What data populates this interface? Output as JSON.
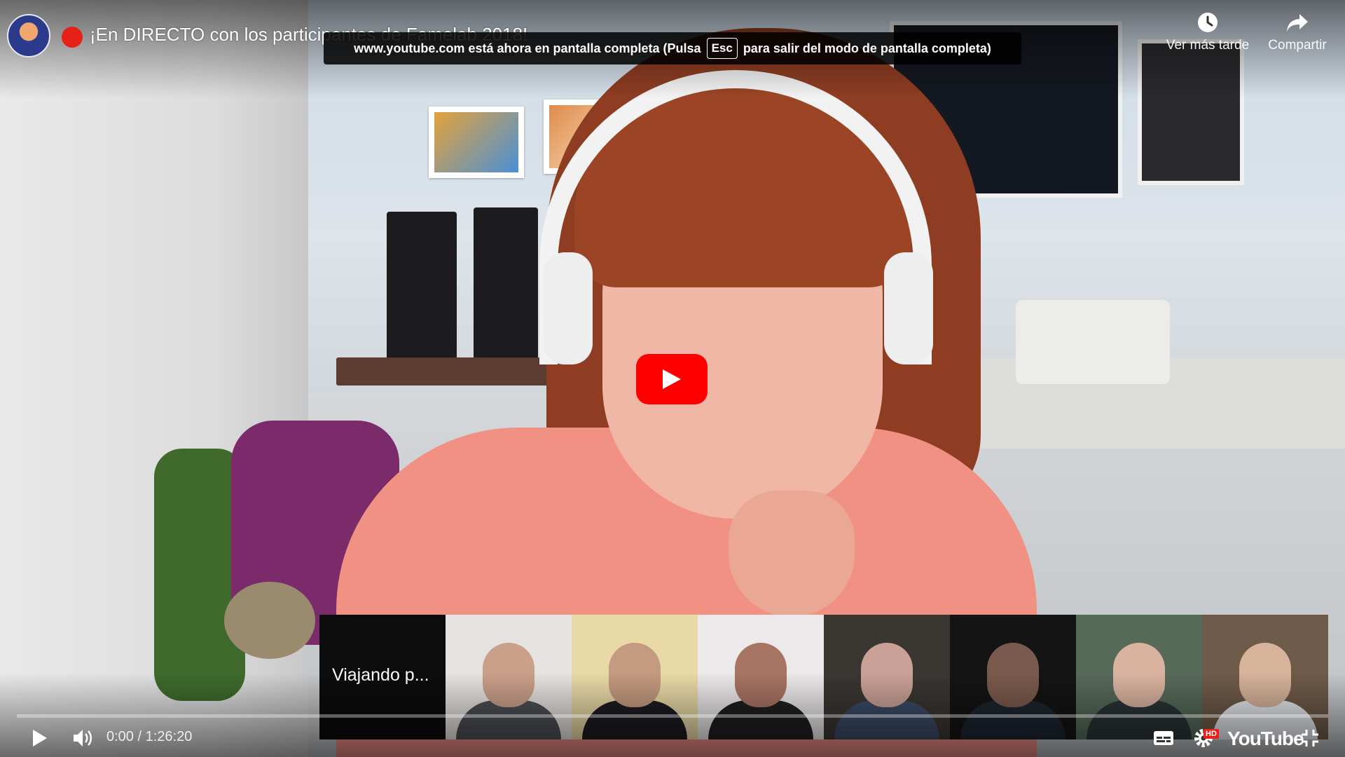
{
  "video": {
    "title": "¡En DIRECTO con los participantes de Famelab 2018!",
    "is_live_indicator_color": "#e62117"
  },
  "fullscreen_notice": {
    "prefix": "www.youtube.com está ahora en pantalla completa (Pulsa",
    "key": "Esc",
    "suffix": "para salir del modo de pantalla completa)"
  },
  "top_actions": {
    "watch_later": "Ver más tarde",
    "share": "Compartir"
  },
  "participants": {
    "tiles": [
      {
        "label": "Viajando p...",
        "bg": "#0c0c0c",
        "skin": "",
        "shirt": ""
      },
      {
        "label": "",
        "bg": "#e6e2df",
        "skin": "#c9a08a",
        "shirt": "#4c4f55"
      },
      {
        "label": "",
        "bg": "#e9d9a6",
        "skin": "#c49a80",
        "shirt": "#1c1c22"
      },
      {
        "label": "",
        "bg": "#ece9ea",
        "skin": "#a87463",
        "shirt": "#1f1f1f"
      },
      {
        "label": "",
        "bg": "#3a3632",
        "skin": "#caa196",
        "shirt": "#3b4b66"
      },
      {
        "label": "",
        "bg": "#141414",
        "skin": "#7a5a4c",
        "shirt": "#1d2630"
      },
      {
        "label": "",
        "bg": "#566a5a",
        "skin": "#d9b3a0",
        "shirt": "#2b3437"
      },
      {
        "label": "",
        "bg": "#6e5a49",
        "skin": "#d6b39b",
        "shirt": "#e5e9ee"
      }
    ]
  },
  "player": {
    "current_time": "0:00",
    "duration": "1:26:20",
    "time_display": "0:00 / 1:26:20",
    "progress_fraction": 0.0,
    "quality_badge": "HD",
    "logo_text": "YouTube",
    "accent_color": "#ff0000"
  }
}
